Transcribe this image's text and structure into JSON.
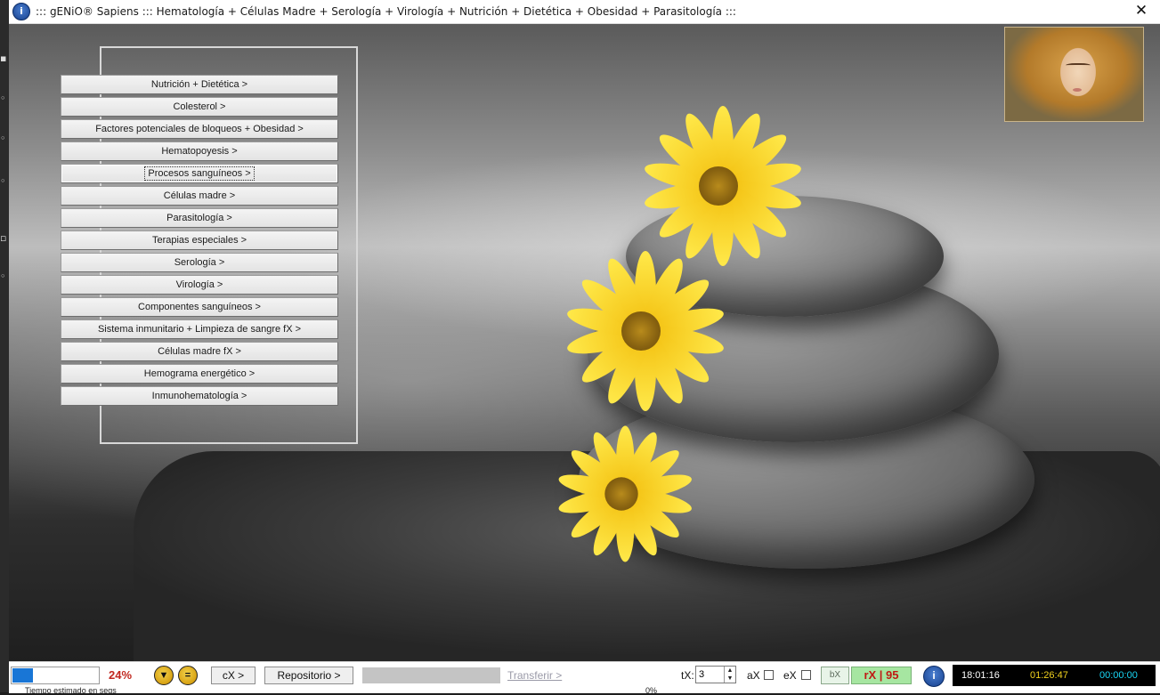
{
  "window": {
    "title": "::: gENiO® Sapiens ::: Hematología + Células Madre + Serología + Virología + Nutrición + Dietética + Obesidad + Parasitología :::",
    "close_glyph": "✕"
  },
  "menu": {
    "items": [
      {
        "label": "Nutrición + Dietética >"
      },
      {
        "label": "Colesterol >"
      },
      {
        "label": "Factores potenciales de bloqueos + Obesidad >"
      },
      {
        "label": "Hematopoyesis >"
      },
      {
        "label": "Procesos sanguíneos >"
      },
      {
        "label": "Células madre >"
      },
      {
        "label": "Parasitología >"
      },
      {
        "label": "Terapias especiales >"
      },
      {
        "label": "Serología >"
      },
      {
        "label": "Virología >"
      },
      {
        "label": "Componentes sanguíneos >"
      },
      {
        "label": "Sistema inmunitario + Limpieza de sangre fX >"
      },
      {
        "label": "Células madre fX >"
      },
      {
        "label": "Hemograma energético >"
      },
      {
        "label": "Inmunohematología >"
      }
    ],
    "focused_index": 4
  },
  "statusbar": {
    "progress_percent": 24,
    "progress_label": "24%",
    "cx_label": "cX >",
    "repositorio_label": "Repositorio >",
    "transferir_label": "Transferir >",
    "tx_label": "tX:",
    "tx_value": "3",
    "ax_label": "aX",
    "ex_label": "eX",
    "bx_label": "bX",
    "rx_label": "rX | 95",
    "clock_time": "18:01:16",
    "elapsed_time": "01:26:47",
    "countdown_time": "00:00:00",
    "estimate_label": "Tiempo estimado en segs",
    "secondary_percent": "0%"
  },
  "colors": {
    "progress_fill": "#1976d6",
    "percent_text": "#c1271f",
    "rx_badge_bg": "#a6e6a1",
    "clock_white": "#ffffff",
    "clock_yellow": "#f2d21e",
    "clock_cyan": "#19d6f5"
  }
}
